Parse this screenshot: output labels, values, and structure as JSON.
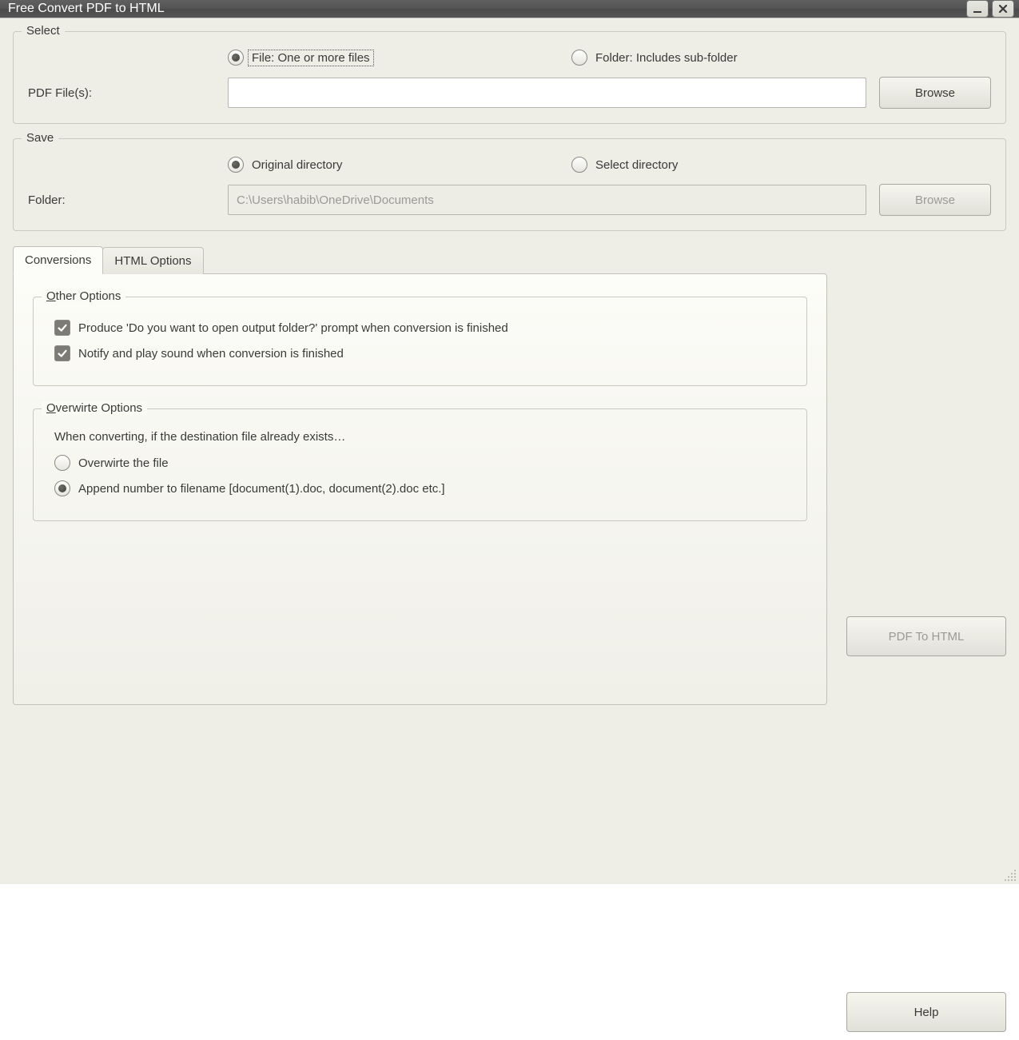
{
  "window": {
    "title": "Free Convert PDF to HTML"
  },
  "select": {
    "legend": "Select",
    "radio_file": "File:  One or more files",
    "radio_folder": "Folder: Includes sub-folder",
    "pdf_files_label": "PDF File(s):",
    "pdf_files_value": "",
    "browse": "Browse"
  },
  "save": {
    "legend": "Save",
    "radio_original": "Original directory",
    "radio_select": "Select directory",
    "folder_label": "Folder:",
    "folder_value": "C:\\Users\\habib\\OneDrive\\Documents",
    "browse": "Browse"
  },
  "tabs": {
    "conversions": "Conversions",
    "html_options": "HTML Options"
  },
  "other_options": {
    "legend_letter": "O",
    "legend_rest": "ther Options",
    "check_prompt": "Produce 'Do you want to open output folder?' prompt when conversion is finished",
    "check_notify": "Notify and play sound when conversion is finished"
  },
  "overwrite_options": {
    "legend_letter": "O",
    "legend_rest": "verwirte Options",
    "description": "When converting, if the destination file already exists…",
    "radio_overwrite": "Overwirte the file",
    "radio_append": "Append number to filename  [document(1).doc, document(2).doc etc.]"
  },
  "buttons": {
    "convert": "PDF To HTML",
    "help": "Help"
  }
}
